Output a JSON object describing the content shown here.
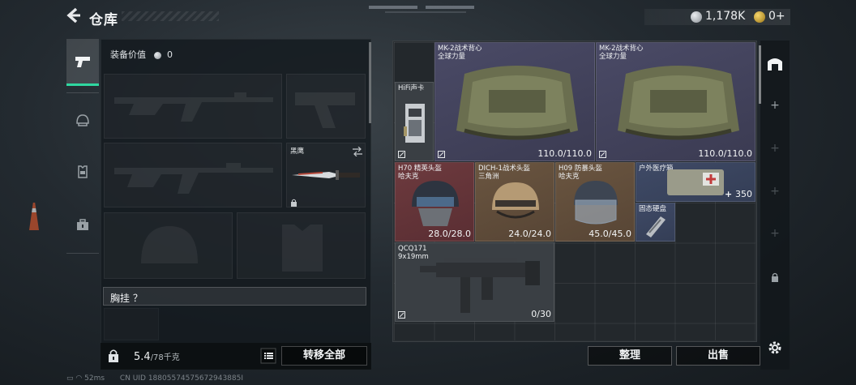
{
  "header": {
    "title": "仓库",
    "currency_silver": "1,178K",
    "currency_gold": "0+"
  },
  "equipment": {
    "value_label": "装备价值",
    "value": "0",
    "slot_knife_name": "黑鹰",
    "section_label": "胸挂 ？",
    "weight_current": "5.4",
    "weight_max": "/78千克",
    "transfer_all": "转移全部"
  },
  "storage": {
    "items": [
      {
        "name": "HiFi声卡",
        "durability": ""
      },
      {
        "name": "MK-2战术背心\n全球力量",
        "durability": "110.0/110.0"
      },
      {
        "name": "MK-2战术背心\n全球力量",
        "durability": "110.0/110.0"
      },
      {
        "name": "H70 精英头盔\n哈夫克",
        "durability": "28.0/28.0"
      },
      {
        "name": "DICH-1战术头盔\n三角洲",
        "durability": "24.0/24.0"
      },
      {
        "name": "H09 防暴头盔\n哈夫克",
        "durability": "45.0/45.0"
      },
      {
        "name": "户外医疗箱",
        "durability": "350"
      },
      {
        "name": "固态硬盘",
        "durability": ""
      },
      {
        "name": "QCQ171\n9x19mm",
        "durability": "0/30"
      }
    ],
    "sort_button": "整理",
    "sell_button": "出售"
  },
  "status": {
    "network": "52ms",
    "uid": "CN UID 18805574575672943885I"
  },
  "colors": {
    "accent": "#2fd7a0",
    "purple_rarity": "#4a4a66",
    "red_rarity": "#6d3a3e",
    "gold_rarity": "#6a5540",
    "blue_rarity": "#3f4a66"
  }
}
